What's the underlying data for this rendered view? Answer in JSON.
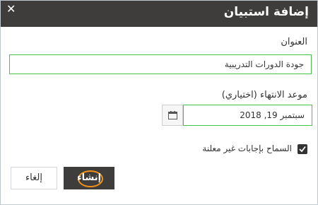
{
  "dialog": {
    "title": "إضافة استبيان",
    "close_glyph": "✕"
  },
  "form": {
    "title_label": "العنوان",
    "title_value": "جودة الدورات التدريبية",
    "deadline_label": "موعد الانتهاء (اختياري)",
    "deadline_value": "سبتمبر 19, 2018",
    "allow_unpublished_label": "السماح بإجابات غير معلنة",
    "allow_unpublished_checked": true
  },
  "buttons": {
    "create_label": "إنشاء",
    "cancel_label": "إلغاء"
  },
  "icons": {
    "close": "close-icon",
    "calendar": "calendar-icon",
    "check": "check-icon"
  },
  "colors": {
    "header_bg": "#3f3d3b",
    "field_border": "#45c34a",
    "highlight_ring": "#f39219"
  }
}
